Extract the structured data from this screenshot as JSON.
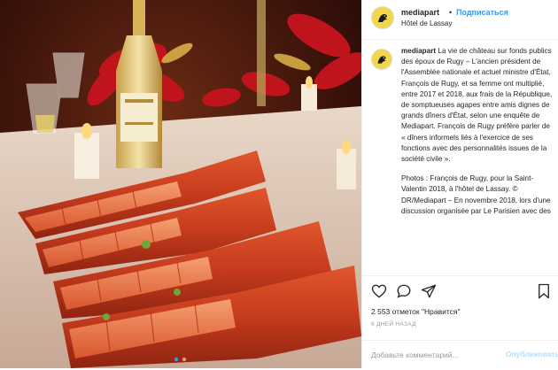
{
  "post": {
    "username": "mediapart",
    "follow_label": "Подписаться",
    "separator": "•",
    "location": "Hôtel de Lassay",
    "caption_username": "mediapart",
    "caption_text": "La vie de château sur fonds publics des époux de Rugy – L'ancien président de l'Assemblée nationale et actuel ministre d'État, François de Rugy, et sa femme ont multiplié, entre 2017 et 2018, aux frais de la République, de somptueuses agapes entre amis dignes de grands dîners d'État, selon une enquête de Mediapart. François de Rugy préfère parler de « dîners informels liés à l'exercice de ses fonctions avec des personnalités issues de la société civile ».",
    "caption_credit": "Photos : François de Rugy, pour la Saint-Valentin 2018, à l'hôtel de Lassay. © DR/Mediapart – En novembre 2018, lors d'une discussion organisée par Le Parisien avec des",
    "likes": "2 553 отметок \"Нравится\"",
    "time_ago": "6 ДНЕЙ НАЗАД",
    "comment_placeholder": "Добавьте комментарий...",
    "post_label": "Опубликовать"
  },
  "icons": {
    "like": "heart-icon",
    "comment": "comment-icon",
    "share": "share-icon",
    "save": "bookmark-icon",
    "avatar": "mediapart-logo"
  },
  "carousel": {
    "count": 2,
    "active": 1
  },
  "colors": {
    "link": "#3897f0",
    "text": "#262626",
    "muted": "#999999",
    "post_disabled": "#b2dffc"
  }
}
